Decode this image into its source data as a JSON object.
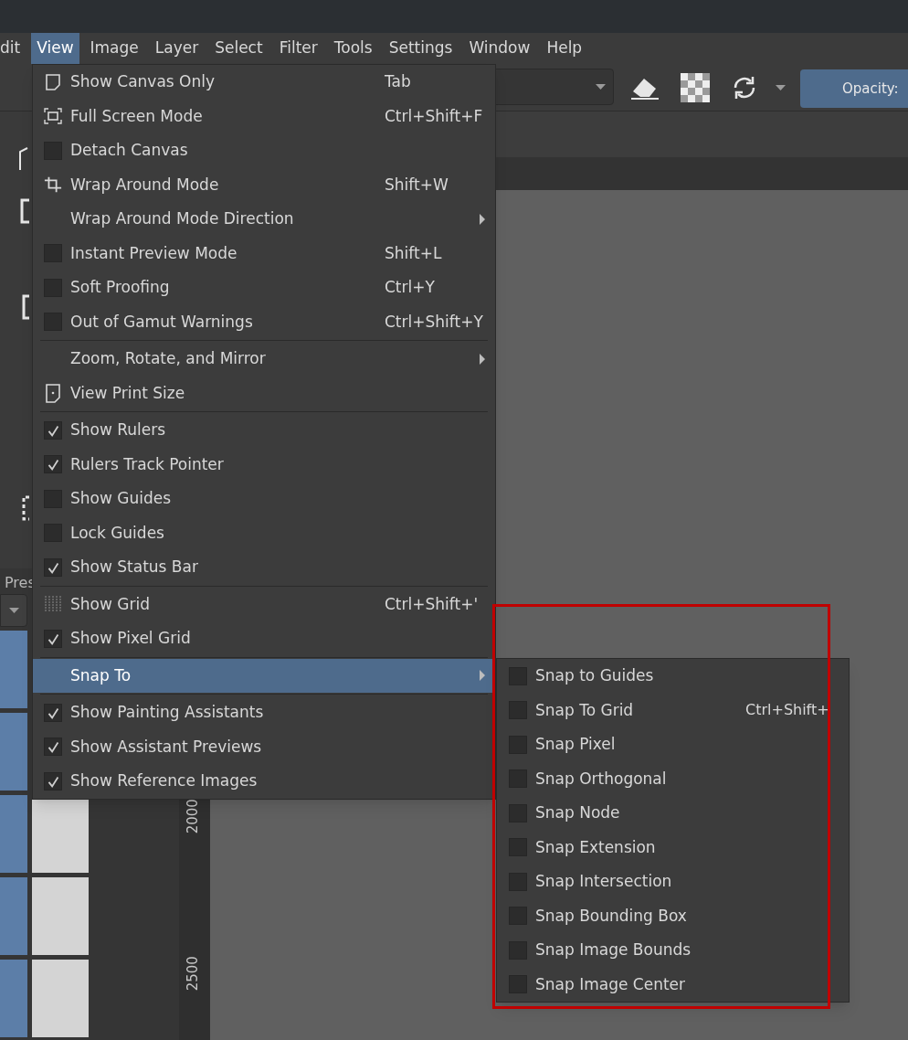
{
  "menubar": [
    {
      "label": "dit",
      "selected": false
    },
    {
      "label": "View",
      "selected": true
    },
    {
      "label": "Image",
      "selected": false
    },
    {
      "label": "Layer",
      "selected": false
    },
    {
      "label": "Select",
      "selected": false
    },
    {
      "label": "Filter",
      "selected": false
    },
    {
      "label": "Tools",
      "selected": false
    },
    {
      "label": "Settings",
      "selected": false
    },
    {
      "label": "Window",
      "selected": false
    },
    {
      "label": "Help",
      "selected": false
    }
  ],
  "toolbar": {
    "opacity_label": "Opacity:"
  },
  "side_panel": {
    "presets_label": "Pres"
  },
  "ruler": {
    "labels": [
      "2000",
      "2500"
    ]
  },
  "view_menu": {
    "sections": [
      [
        {
          "label": "Show Canvas Only",
          "shortcut": "Tab",
          "kind": "page",
          "selected": false
        },
        {
          "label": "Full Screen Mode",
          "shortcut": "Ctrl+Shift+F",
          "kind": "fullscreen",
          "selected": false
        },
        {
          "label": "Detach Canvas",
          "kind": "check",
          "checked": false,
          "selected": false
        },
        {
          "label": "Wrap Around Mode",
          "shortcut": "Shift+W",
          "kind": "crop",
          "selected": false
        },
        {
          "label": "Wrap Around Mode Direction",
          "kind": "submenu",
          "selected": false
        },
        {
          "label": "Instant Preview Mode",
          "shortcut": "Shift+L",
          "kind": "check",
          "checked": false,
          "selected": false
        },
        {
          "label": "Soft Proofing",
          "shortcut": "Ctrl+Y",
          "kind": "check",
          "checked": false,
          "selected": false
        },
        {
          "label": "Out of Gamut Warnings",
          "shortcut": "Ctrl+Shift+Y",
          "kind": "check",
          "checked": false,
          "selected": false
        }
      ],
      [
        {
          "label": "Zoom, Rotate, and Mirror",
          "kind": "submenu",
          "selected": false
        },
        {
          "label": "View Print Size",
          "kind": "print",
          "selected": false
        }
      ],
      [
        {
          "label": "Show Rulers",
          "kind": "check",
          "checked": true,
          "selected": false
        },
        {
          "label": "Rulers Track Pointer",
          "kind": "check",
          "checked": true,
          "selected": false
        },
        {
          "label": "Show Guides",
          "kind": "check",
          "checked": false,
          "selected": false
        },
        {
          "label": "Lock Guides",
          "kind": "check",
          "checked": false,
          "selected": false
        },
        {
          "label": "Show Status Bar",
          "kind": "check",
          "checked": true,
          "selected": false
        }
      ],
      [
        {
          "label": "Show Grid",
          "shortcut": "Ctrl+Shift+'",
          "kind": "grid",
          "selected": false
        },
        {
          "label": "Show Pixel Grid",
          "kind": "check",
          "checked": true,
          "selected": false
        }
      ],
      [
        {
          "label": "Snap To",
          "kind": "submenu",
          "selected": true
        }
      ],
      [
        {
          "label": "Show Painting Assistants",
          "kind": "check",
          "checked": true,
          "selected": false
        },
        {
          "label": "Show Assistant Previews",
          "kind": "check",
          "checked": true,
          "selected": false
        },
        {
          "label": "Show Reference Images",
          "kind": "check",
          "checked": true,
          "selected": false
        }
      ]
    ]
  },
  "snap_submenu": {
    "items": [
      {
        "label": "Snap to Guides",
        "checked": false
      },
      {
        "label": "Snap To Grid",
        "shortcut": "Ctrl+Shift+",
        "checked": false
      },
      {
        "label": "Snap Pixel",
        "checked": false
      },
      {
        "label": "Snap Orthogonal",
        "checked": false
      },
      {
        "label": "Snap Node",
        "checked": false
      },
      {
        "label": "Snap Extension",
        "checked": false
      },
      {
        "label": "Snap Intersection",
        "checked": false
      },
      {
        "label": "Snap Bounding Box",
        "checked": false
      },
      {
        "label": "Snap Image Bounds",
        "checked": false
      },
      {
        "label": "Snap Image Center",
        "checked": false
      }
    ]
  }
}
